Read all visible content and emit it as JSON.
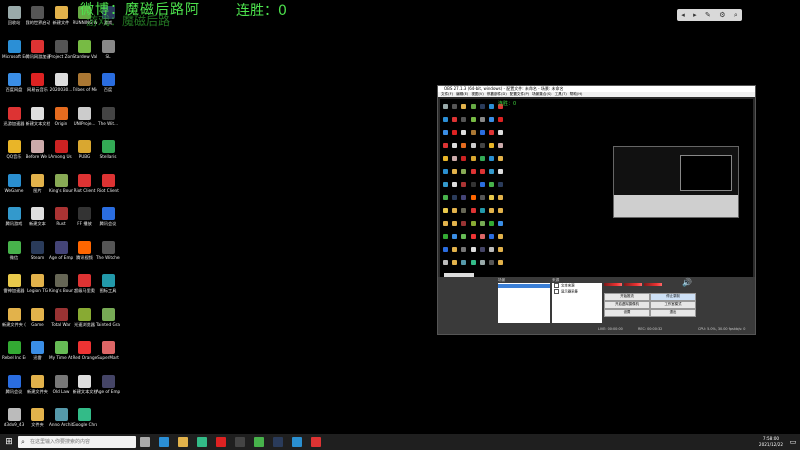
{
  "overlay": {
    "title": "微博：魔磁后路阿",
    "subtitle": "游戏：魔磁后路",
    "streak": "连胜：0"
  },
  "tray_tools": [
    "◂",
    "▸",
    "✎",
    "⚙",
    "⌕"
  ],
  "desktop_icons": [
    {
      "label": "回收站",
      "color": "#9aa"
    },
    {
      "label": "Microsoft Edge",
      "color": "#2b8fd6"
    },
    {
      "label": "百度网盘",
      "color": "#3a8ee6"
    },
    {
      "label": "迅游加速器",
      "color": "#d33"
    },
    {
      "label": "QQ音乐",
      "color": "#e9b528"
    },
    {
      "label": "WeGame",
      "color": "#2a8fd0"
    },
    {
      "label": "腾讯游戏",
      "color": "#39c"
    },
    {
      "label": "微信",
      "color": "#47b24b"
    },
    {
      "label": "雷神加速器",
      "color": "#e9c94b"
    },
    {
      "label": "新建文件夹 (2)",
      "color": "#e2b24b"
    },
    {
      "label": "Rebel Inc Escalation",
      "color": "#3a3"
    },
    {
      "label": "腾讯会议",
      "color": "#2a6de0"
    },
    {
      "label": "d3dx9_43",
      "color": "#bbb"
    },
    {
      "label": "我的世界启动器",
      "color": "#555"
    },
    {
      "label": "腾讯网游加速器",
      "color": "#d33"
    },
    {
      "label": "网易云音乐",
      "color": "#d22"
    },
    {
      "label": "新建文本文档",
      "color": "#ddd"
    },
    {
      "label": "Before We Leave",
      "color": "#caa"
    },
    {
      "label": "图片",
      "color": "#e2b24b"
    },
    {
      "label": "新建文本",
      "color": "#ddd"
    },
    {
      "label": "Steam",
      "color": "#2a3b5a"
    },
    {
      "label": "Legion TG",
      "color": "#e2b24b"
    },
    {
      "label": "Game",
      "color": "#e2b24b"
    },
    {
      "label": "迅雷",
      "color": "#3a8ee6"
    },
    {
      "label": "新建文件夹",
      "color": "#e2b24b"
    },
    {
      "label": "文件夹",
      "color": "#e2b24b"
    },
    {
      "label": "新建文件",
      "color": "#e2b24b"
    },
    {
      "label": "Project Zomboid",
      "color": "#555"
    },
    {
      "label": "2020030...",
      "color": "#ddd"
    },
    {
      "label": "Origin",
      "color": "#e56b1f"
    },
    {
      "label": "Among Us",
      "color": "#c22"
    },
    {
      "label": "King's Bounty II",
      "color": "#8a5"
    },
    {
      "label": "Rust",
      "color": "#a33"
    },
    {
      "label": "Age of Empires",
      "color": "#447"
    },
    {
      "label": "King's Bounty",
      "color": "#665"
    },
    {
      "label": "Total War",
      "color": "#933"
    },
    {
      "label": "My Time At Portia",
      "color": "#6b5"
    },
    {
      "label": "Old Law",
      "color": "#777"
    },
    {
      "label": "Anno Architect",
      "color": "#59a"
    },
    {
      "label": "RUNNING WITH RI",
      "color": "#6a4"
    },
    {
      "label": "Stardew Valley",
      "color": "#7b4"
    },
    {
      "label": "Tribes of Midgard",
      "color": "#a73"
    },
    {
      "label": "UNIProje...",
      "color": "#ccc"
    },
    {
      "label": "PUBG",
      "color": "#d9a730"
    },
    {
      "label": "Riot Client",
      "color": "#d33"
    },
    {
      "label": "FF 播放",
      "color": "#333"
    },
    {
      "label": "腾讯视频",
      "color": "#f60"
    },
    {
      "label": "超级马里奥",
      "color": "#d33"
    },
    {
      "label": "光速浏览器",
      "color": "#8a3"
    },
    {
      "label": "Red Orange",
      "color": "#e33"
    },
    {
      "label": "新建文本文档 (5)",
      "color": "#ddd"
    },
    {
      "label": "Google Chrome",
      "color": "#3b8"
    },
    {
      "label": "游戏",
      "color": "#2a3b5a"
    },
    {
      "label": "SL",
      "color": "#888"
    },
    {
      "label": "百度",
      "color": "#2a6de0"
    },
    {
      "label": "The Wit...",
      "color": "#444"
    },
    {
      "label": "Stellaris",
      "color": "#3a5"
    },
    {
      "label": "Riot Client",
      "color": "#d33"
    },
    {
      "label": "腾讯会议",
      "color": "#2a6de0"
    },
    {
      "label": "The Witcher",
      "color": "#555"
    },
    {
      "label": "图标工具",
      "color": "#29a"
    },
    {
      "label": "Tainted Grail",
      "color": "#7a5"
    },
    {
      "label": "SuperMart",
      "color": "#d66"
    },
    {
      "label": "Age of Empires IV",
      "color": "#446"
    }
  ],
  "obs": {
    "window_title": "OBS 27.1.3 (64-bit, windows) - 配置文件: 未命名 - 场景: 未命名",
    "menu": [
      "文件(F)",
      "编辑(E)",
      "视图(V)",
      "停靠部件(D)",
      "配置文件(P)",
      "场景集合(S)",
      "工具(T)",
      "帮助(H)"
    ],
    "preview_overlay": "连胜：0",
    "scenes_header": "场景",
    "scene_item": "场景",
    "sources_header": "来源",
    "sources": [
      "文本来源",
      "显示器采集"
    ],
    "controls": [
      {
        "label": "开始推流",
        "primary": false
      },
      {
        "label": "停止录制",
        "primary": true
      },
      {
        "label": "开启虚拟摄像机",
        "primary": false
      },
      {
        "label": "工作室模式",
        "primary": false
      },
      {
        "label": "设置",
        "primary": false
      },
      {
        "label": "退出",
        "primary": false
      }
    ],
    "status": [
      "LIVE: 00:00:00",
      "REC: 00:00:32",
      "CPU: 5.0%, 30.00 fps",
      "kb/s: 0"
    ]
  },
  "taskbar": {
    "start_icon": "windows-logo",
    "search_placeholder": "在这里输入你要搜索的内容",
    "apps": [
      {
        "name": "task-view",
        "color": "#aaa"
      },
      {
        "name": "edge",
        "color": "#2b8fd6"
      },
      {
        "name": "explorer",
        "color": "#e2b24b"
      },
      {
        "name": "chrome",
        "color": "#3b8"
      },
      {
        "name": "netease",
        "color": "#d22"
      },
      {
        "name": "obs",
        "color": "#444"
      },
      {
        "name": "wechat",
        "color": "#47b24b"
      },
      {
        "name": "steam",
        "color": "#2a3b5a"
      },
      {
        "name": "qq",
        "color": "#2a8fd0"
      },
      {
        "name": "music",
        "color": "#d33"
      }
    ],
    "time": "7:58:00",
    "date": "2021/12/22"
  }
}
